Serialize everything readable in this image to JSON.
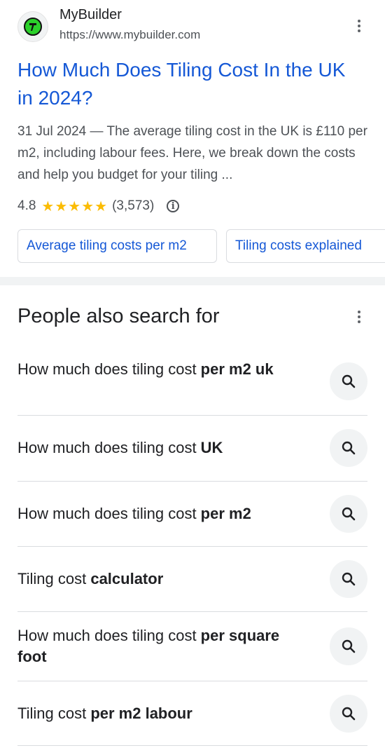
{
  "result": {
    "site_name": "MyBuilder",
    "site_url": "https://www.mybuilder.com",
    "title": "How Much Does Tiling Cost In the UK in 2024?",
    "snippet": "31 Jul 2024 — The average tiling cost in the UK is £110 per m2, including labour fees. Here, we break down the costs and help you budget for your tiling ...",
    "rating": "4.8",
    "stars": "★★★★★",
    "review_count": "(3,573)",
    "chips": [
      "Average tiling costs per m2",
      "Tiling costs explained"
    ]
  },
  "pasf": {
    "heading": "People also search for",
    "items": [
      {
        "normal": "How much does tiling cost ",
        "bold": "per m2 uk"
      },
      {
        "normal": "How much does tiling cost ",
        "bold": "UK"
      },
      {
        "normal": "How much does tiling cost ",
        "bold": "per m2"
      },
      {
        "normal": "Tiling cost ",
        "bold": "calculator"
      },
      {
        "normal": "How much does tiling cost ",
        "bold": "per square foot"
      },
      {
        "normal": "Tiling cost ",
        "bold": "per m2 labour"
      }
    ]
  },
  "icons": {
    "favicon": "hammer-logo-icon",
    "more": "more-vert-icon",
    "info": "info-icon",
    "search": "search-icon"
  },
  "colors": {
    "link": "#1558d6",
    "star": "#fbbc04",
    "brand_green": "#2bd12b"
  }
}
